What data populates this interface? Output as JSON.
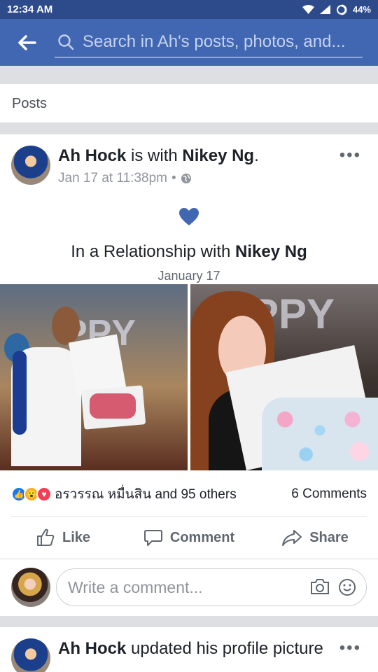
{
  "status": {
    "time": "12:34 AM",
    "battery": "44%"
  },
  "header": {
    "search_placeholder": "Search in Ah's posts, photos, and..."
  },
  "section": {
    "title": "Posts"
  },
  "post": {
    "author": "Ah Hock",
    "connector": "is with",
    "with": "Nikey Ng",
    "timestamp": "Jan 17 at 11:38pm",
    "separator": "•",
    "event_prefix": "In a Relationship with",
    "event_person": "Nikey Ng",
    "event_date": "January 17",
    "reactors": "อรวรรณ หมื่นสิน and 95 others",
    "comments_count": "6 Comments"
  },
  "actions": {
    "like": "Like",
    "comment": "Comment",
    "share": "Share"
  },
  "comment_box": {
    "placeholder": "Write a comment..."
  },
  "next_post": {
    "author": "Ah Hock",
    "action": "updated his profile picture"
  },
  "colors": {
    "brand": "#4267b2",
    "heart": "#4267b2"
  },
  "icons": [
    "back-arrow-icon",
    "search-icon",
    "globe-icon",
    "heart-icon",
    "like-icon",
    "comment-icon",
    "share-icon",
    "camera-icon",
    "emoji-icon",
    "more-icon"
  ]
}
